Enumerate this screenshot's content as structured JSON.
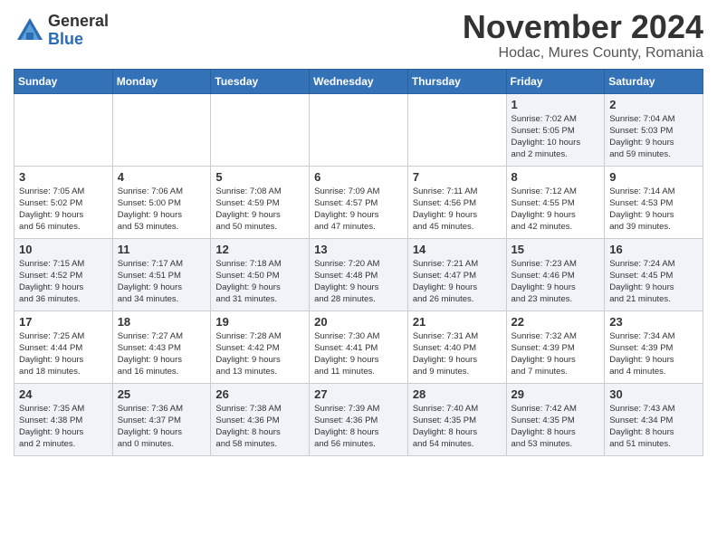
{
  "header": {
    "logo_general": "General",
    "logo_blue": "Blue",
    "month": "November 2024",
    "location": "Hodac, Mures County, Romania"
  },
  "days_of_week": [
    "Sunday",
    "Monday",
    "Tuesday",
    "Wednesday",
    "Thursday",
    "Friday",
    "Saturday"
  ],
  "weeks": [
    [
      {
        "day": "",
        "info": ""
      },
      {
        "day": "",
        "info": ""
      },
      {
        "day": "",
        "info": ""
      },
      {
        "day": "",
        "info": ""
      },
      {
        "day": "",
        "info": ""
      },
      {
        "day": "1",
        "info": "Sunrise: 7:02 AM\nSunset: 5:05 PM\nDaylight: 10 hours\nand 2 minutes."
      },
      {
        "day": "2",
        "info": "Sunrise: 7:04 AM\nSunset: 5:03 PM\nDaylight: 9 hours\nand 59 minutes."
      }
    ],
    [
      {
        "day": "3",
        "info": "Sunrise: 7:05 AM\nSunset: 5:02 PM\nDaylight: 9 hours\nand 56 minutes."
      },
      {
        "day": "4",
        "info": "Sunrise: 7:06 AM\nSunset: 5:00 PM\nDaylight: 9 hours\nand 53 minutes."
      },
      {
        "day": "5",
        "info": "Sunrise: 7:08 AM\nSunset: 4:59 PM\nDaylight: 9 hours\nand 50 minutes."
      },
      {
        "day": "6",
        "info": "Sunrise: 7:09 AM\nSunset: 4:57 PM\nDaylight: 9 hours\nand 47 minutes."
      },
      {
        "day": "7",
        "info": "Sunrise: 7:11 AM\nSunset: 4:56 PM\nDaylight: 9 hours\nand 45 minutes."
      },
      {
        "day": "8",
        "info": "Sunrise: 7:12 AM\nSunset: 4:55 PM\nDaylight: 9 hours\nand 42 minutes."
      },
      {
        "day": "9",
        "info": "Sunrise: 7:14 AM\nSunset: 4:53 PM\nDaylight: 9 hours\nand 39 minutes."
      }
    ],
    [
      {
        "day": "10",
        "info": "Sunrise: 7:15 AM\nSunset: 4:52 PM\nDaylight: 9 hours\nand 36 minutes."
      },
      {
        "day": "11",
        "info": "Sunrise: 7:17 AM\nSunset: 4:51 PM\nDaylight: 9 hours\nand 34 minutes."
      },
      {
        "day": "12",
        "info": "Sunrise: 7:18 AM\nSunset: 4:50 PM\nDaylight: 9 hours\nand 31 minutes."
      },
      {
        "day": "13",
        "info": "Sunrise: 7:20 AM\nSunset: 4:48 PM\nDaylight: 9 hours\nand 28 minutes."
      },
      {
        "day": "14",
        "info": "Sunrise: 7:21 AM\nSunset: 4:47 PM\nDaylight: 9 hours\nand 26 minutes."
      },
      {
        "day": "15",
        "info": "Sunrise: 7:23 AM\nSunset: 4:46 PM\nDaylight: 9 hours\nand 23 minutes."
      },
      {
        "day": "16",
        "info": "Sunrise: 7:24 AM\nSunset: 4:45 PM\nDaylight: 9 hours\nand 21 minutes."
      }
    ],
    [
      {
        "day": "17",
        "info": "Sunrise: 7:25 AM\nSunset: 4:44 PM\nDaylight: 9 hours\nand 18 minutes."
      },
      {
        "day": "18",
        "info": "Sunrise: 7:27 AM\nSunset: 4:43 PM\nDaylight: 9 hours\nand 16 minutes."
      },
      {
        "day": "19",
        "info": "Sunrise: 7:28 AM\nSunset: 4:42 PM\nDaylight: 9 hours\nand 13 minutes."
      },
      {
        "day": "20",
        "info": "Sunrise: 7:30 AM\nSunset: 4:41 PM\nDaylight: 9 hours\nand 11 minutes."
      },
      {
        "day": "21",
        "info": "Sunrise: 7:31 AM\nSunset: 4:40 PM\nDaylight: 9 hours\nand 9 minutes."
      },
      {
        "day": "22",
        "info": "Sunrise: 7:32 AM\nSunset: 4:39 PM\nDaylight: 9 hours\nand 7 minutes."
      },
      {
        "day": "23",
        "info": "Sunrise: 7:34 AM\nSunset: 4:39 PM\nDaylight: 9 hours\nand 4 minutes."
      }
    ],
    [
      {
        "day": "24",
        "info": "Sunrise: 7:35 AM\nSunset: 4:38 PM\nDaylight: 9 hours\nand 2 minutes."
      },
      {
        "day": "25",
        "info": "Sunrise: 7:36 AM\nSunset: 4:37 PM\nDaylight: 9 hours\nand 0 minutes."
      },
      {
        "day": "26",
        "info": "Sunrise: 7:38 AM\nSunset: 4:36 PM\nDaylight: 8 hours\nand 58 minutes."
      },
      {
        "day": "27",
        "info": "Sunrise: 7:39 AM\nSunset: 4:36 PM\nDaylight: 8 hours\nand 56 minutes."
      },
      {
        "day": "28",
        "info": "Sunrise: 7:40 AM\nSunset: 4:35 PM\nDaylight: 8 hours\nand 54 minutes."
      },
      {
        "day": "29",
        "info": "Sunrise: 7:42 AM\nSunset: 4:35 PM\nDaylight: 8 hours\nand 53 minutes."
      },
      {
        "day": "30",
        "info": "Sunrise: 7:43 AM\nSunset: 4:34 PM\nDaylight: 8 hours\nand 51 minutes."
      }
    ]
  ]
}
